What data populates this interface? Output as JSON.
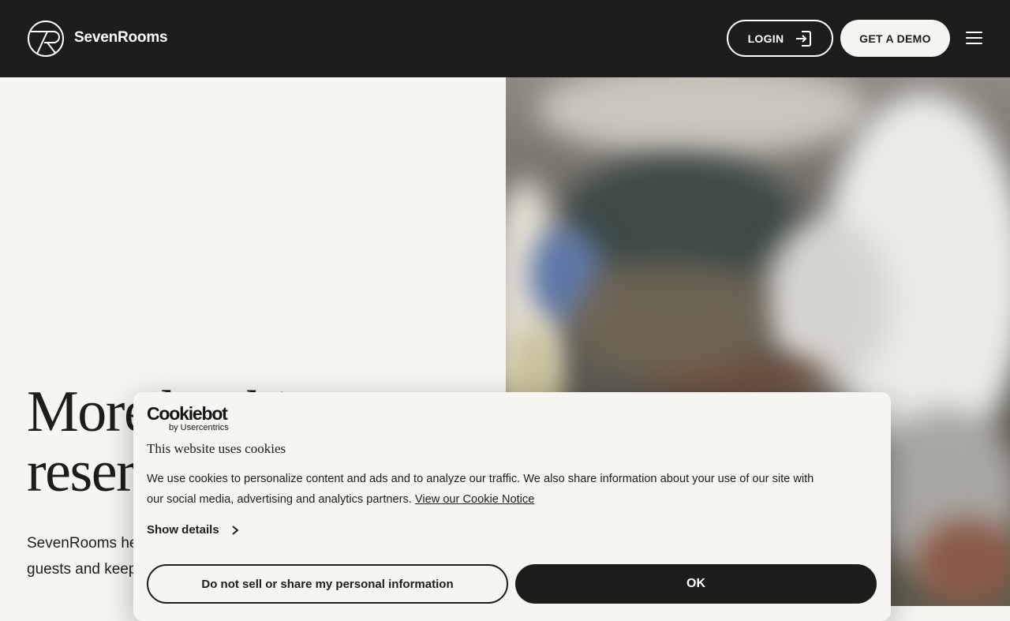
{
  "header": {
    "brand": "SevenRooms",
    "login_label": "LOGIN",
    "demo_label": "GET A DEMO"
  },
  "hero": {
    "heading_line1": "More bookings,",
    "heading_line2": "reservations",
    "subtext_line1": "SevenRooms helps restaurants turn",
    "subtext_line2": "guests and keep them coming back."
  },
  "cookie_banner": {
    "logo_main": "Cookiebot",
    "logo_sub": "by Usercentrics",
    "title": "This website uses cookies",
    "text_line1": "We use cookies to personalize content and ads and to analyze our traffic. We also share information about your use of our site with",
    "text_line2": "our social media, advertising and analytics partners.",
    "link_label": "View our Cookie Notice",
    "show_details_label": "Show details",
    "do_not_sell_label": "Do not sell or share my personal information",
    "ok_label": "OK"
  },
  "colors": {
    "dark": "#1f1d1b",
    "cream": "#f7f5f1",
    "white": "#ffffff"
  }
}
